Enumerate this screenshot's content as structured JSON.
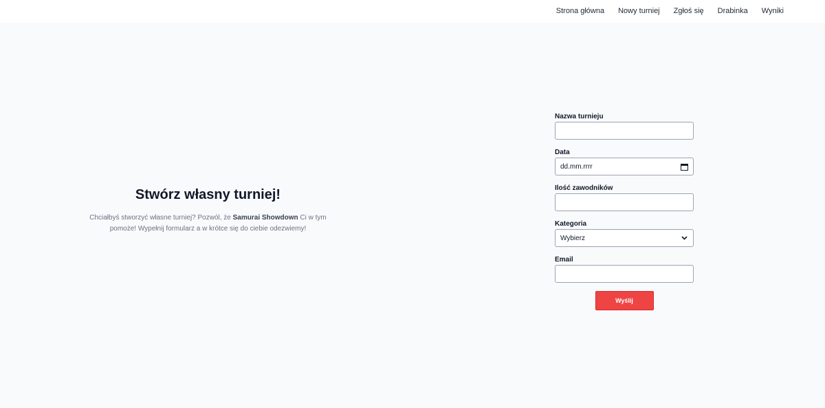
{
  "nav": {
    "items": [
      {
        "label": "Strona główna"
      },
      {
        "label": "Nowy turniej"
      },
      {
        "label": "Zgłoś się"
      },
      {
        "label": "Drabinka"
      },
      {
        "label": "Wyniki"
      }
    ]
  },
  "hero": {
    "title": "Stwórz własny turniej!",
    "text_before": "Chciałbyś stworzyć własne turniej? Pozwól, że ",
    "text_bold": "Samurai Showdown",
    "text_after": " Ci w tym pomoże! Wypełnij formularz a w krótce się do ciebie odezwiemy!"
  },
  "form": {
    "name_label": "Nazwa turnieju",
    "name_value": "",
    "date_label": "Data",
    "date_placeholder": "dd.mm.rrrr",
    "players_label": "Ilość zawodników",
    "players_value": "",
    "category_label": "Kategoria",
    "category_selected": "Wybierz",
    "email_label": "Email",
    "email_value": "",
    "submit_label": "Wyślij"
  },
  "icons": {
    "date": "calendar-icon",
    "select": "chevron-down-icon"
  },
  "colors": {
    "background": "#f8fafc",
    "submit": "#ef4444"
  }
}
